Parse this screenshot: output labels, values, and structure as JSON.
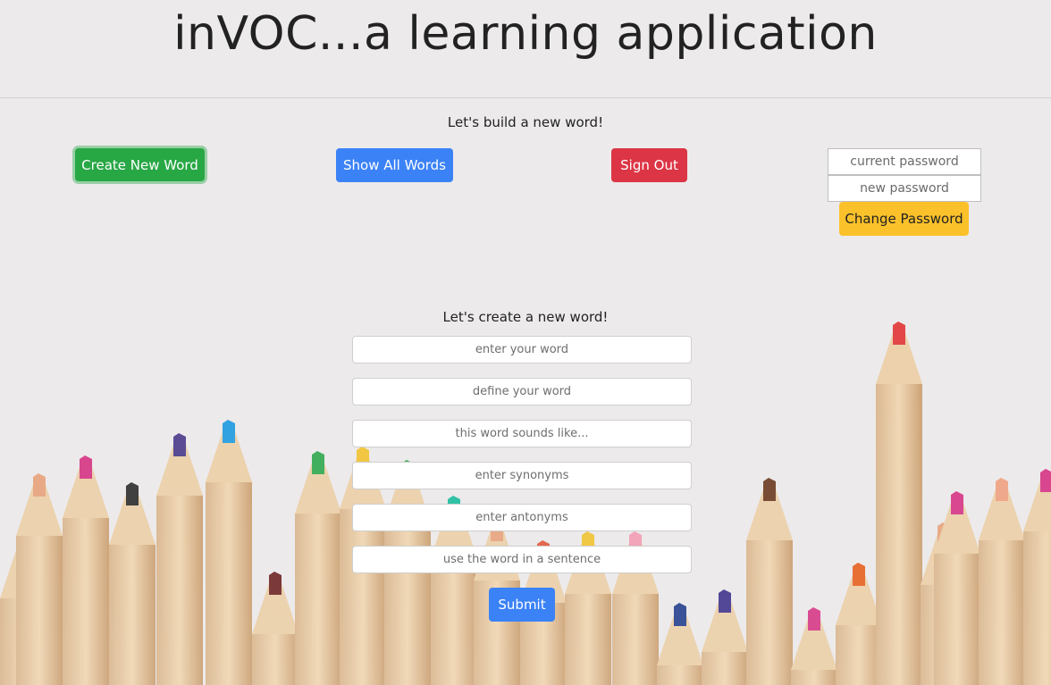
{
  "app": {
    "title": "inVOC...a learning application",
    "subtitle": "Let's build a new word!"
  },
  "nav": {
    "create_label": "Create New Word",
    "show_label": "Show All Words",
    "signout_label": "Sign Out"
  },
  "password": {
    "current_placeholder": "current password",
    "new_placeholder": "new password",
    "change_label": "Change Password"
  },
  "form": {
    "title": "Let's create a new word!",
    "word_placeholder": "enter your word",
    "definition_placeholder": "define your word",
    "sounds_like_placeholder": "this word sounds like...",
    "synonyms_placeholder": "enter synonyms",
    "antonyms_placeholder": "enter antonyms",
    "sentence_placeholder": "use the word in a sentence",
    "submit_label": "Submit"
  },
  "colors": {
    "create": "#28a745",
    "show": "#3b82f6",
    "signout": "#dc3545",
    "change": "#fbc12a",
    "submit": "#3b82f6"
  },
  "background": "colored-pencils-photo"
}
